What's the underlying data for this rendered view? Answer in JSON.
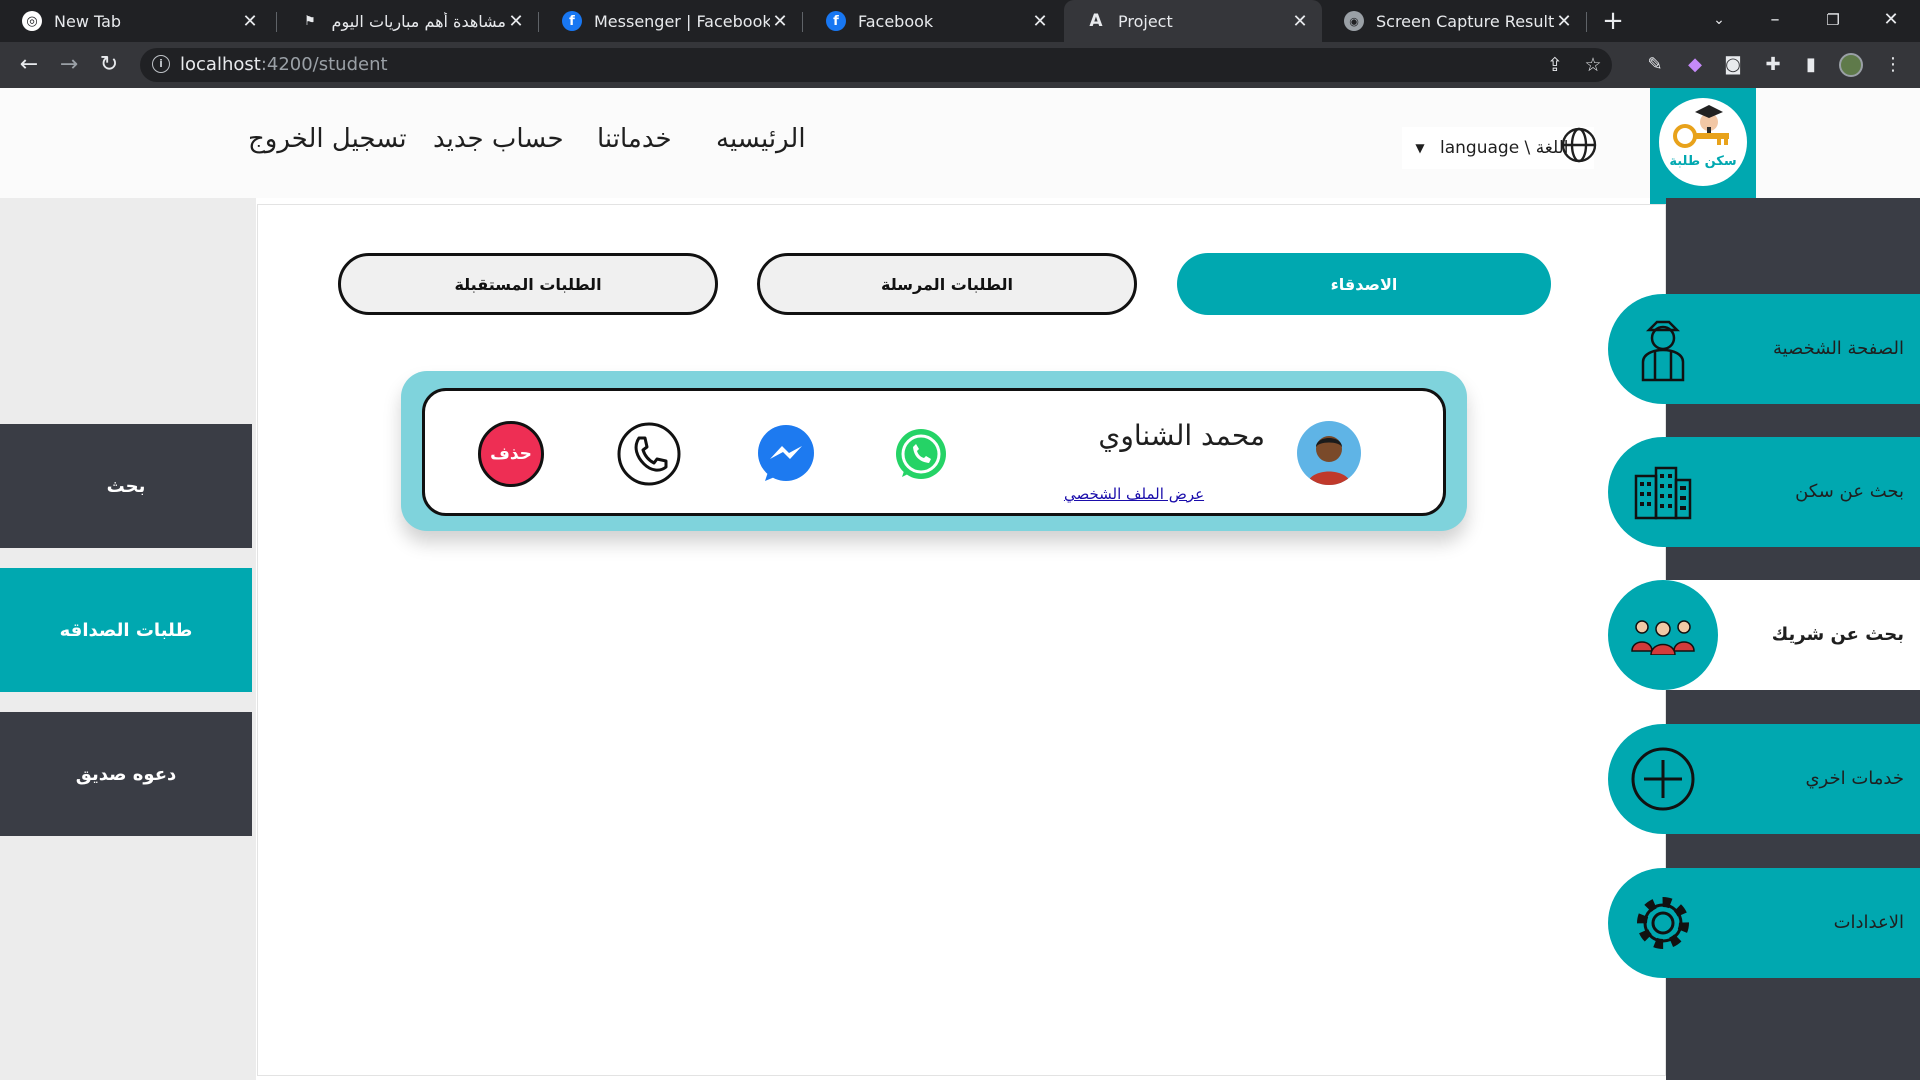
{
  "browser": {
    "tabs": [
      {
        "title": "New Tab",
        "icon": "chrome-icon",
        "active": false
      },
      {
        "title": "مشاهدة أهم مباريات اليوم | أ",
        "icon": "sports-site-icon",
        "active": false
      },
      {
        "title": "Messenger | Facebook",
        "icon": "facebook-icon",
        "active": false
      },
      {
        "title": "Facebook",
        "icon": "facebook-icon",
        "active": false
      },
      {
        "title": "Project",
        "icon": "angular-icon",
        "active": true
      },
      {
        "title": "Screen Capture Result",
        "icon": "camera-icon",
        "active": false
      }
    ],
    "url_host": "localhost",
    "url_path": ":4200/student"
  },
  "header": {
    "nav": {
      "home": "الرئيسيه",
      "services": "خدماتنا",
      "register": "حساب جديد",
      "logout": "تسجيل الخروج"
    },
    "language_label": "language \\ اللغة",
    "logo_text": "سكن طلبة"
  },
  "left_menu": {
    "items": [
      {
        "label": "بحث",
        "active": false
      },
      {
        "label": "طلبات الصداقه",
        "active": true
      },
      {
        "label": "دعوه صديق",
        "active": false
      }
    ]
  },
  "right_menu": {
    "items": [
      {
        "label": "الصفحة الشخصية",
        "icon": "student-icon",
        "active": false
      },
      {
        "label": "بحث عن سكن",
        "icon": "building-icon",
        "active": false
      },
      {
        "label": "بحث عن شريك",
        "icon": "group-icon",
        "active": true
      },
      {
        "label": "خدمات اخري",
        "icon": "plus-circle-icon",
        "active": false
      },
      {
        "label": "الاعدادات",
        "icon": "gear-icon",
        "active": false
      }
    ]
  },
  "tabs": {
    "friends": "الاصدقاء",
    "sent": "الطلبات المرسلة",
    "received": "الطلبات المستقبلة"
  },
  "friend": {
    "name": "محمد الشناوي",
    "profile_link": "عرض الملف الشخصي",
    "delete_label": "حذف"
  },
  "colors": {
    "accent": "#00a8b0",
    "dark_panel": "#3a3d45",
    "card_outer": "#7fd3dc",
    "delete": "#ee2e54"
  }
}
